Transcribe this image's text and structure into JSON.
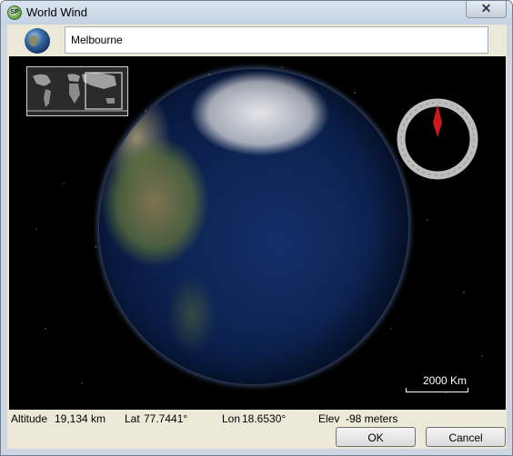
{
  "window": {
    "title": "World Wind",
    "close_label": "✕"
  },
  "search": {
    "value": "Melbourne"
  },
  "viewport": {
    "scale_label": "2000 Km"
  },
  "status": {
    "altitude_label": "Altitude",
    "altitude_value": "19,134 km",
    "lat_label": "Lat",
    "lat_value": "77.7441°",
    "lon_label": "Lon",
    "lon_value": "18.6530°",
    "elev_label": "Elev",
    "elev_value": "-98 meters"
  },
  "buttons": {
    "ok_label": "OK",
    "cancel_label": "Cancel"
  },
  "colors": {
    "window_border": "#6e7f91",
    "client_bg": "#ece9d8",
    "compass_needle": "#cc1a1a"
  },
  "icons": {
    "app": "world-wind-app-icon",
    "close": "close-icon",
    "globe": "globe-icon",
    "compass": "compass-icon"
  }
}
